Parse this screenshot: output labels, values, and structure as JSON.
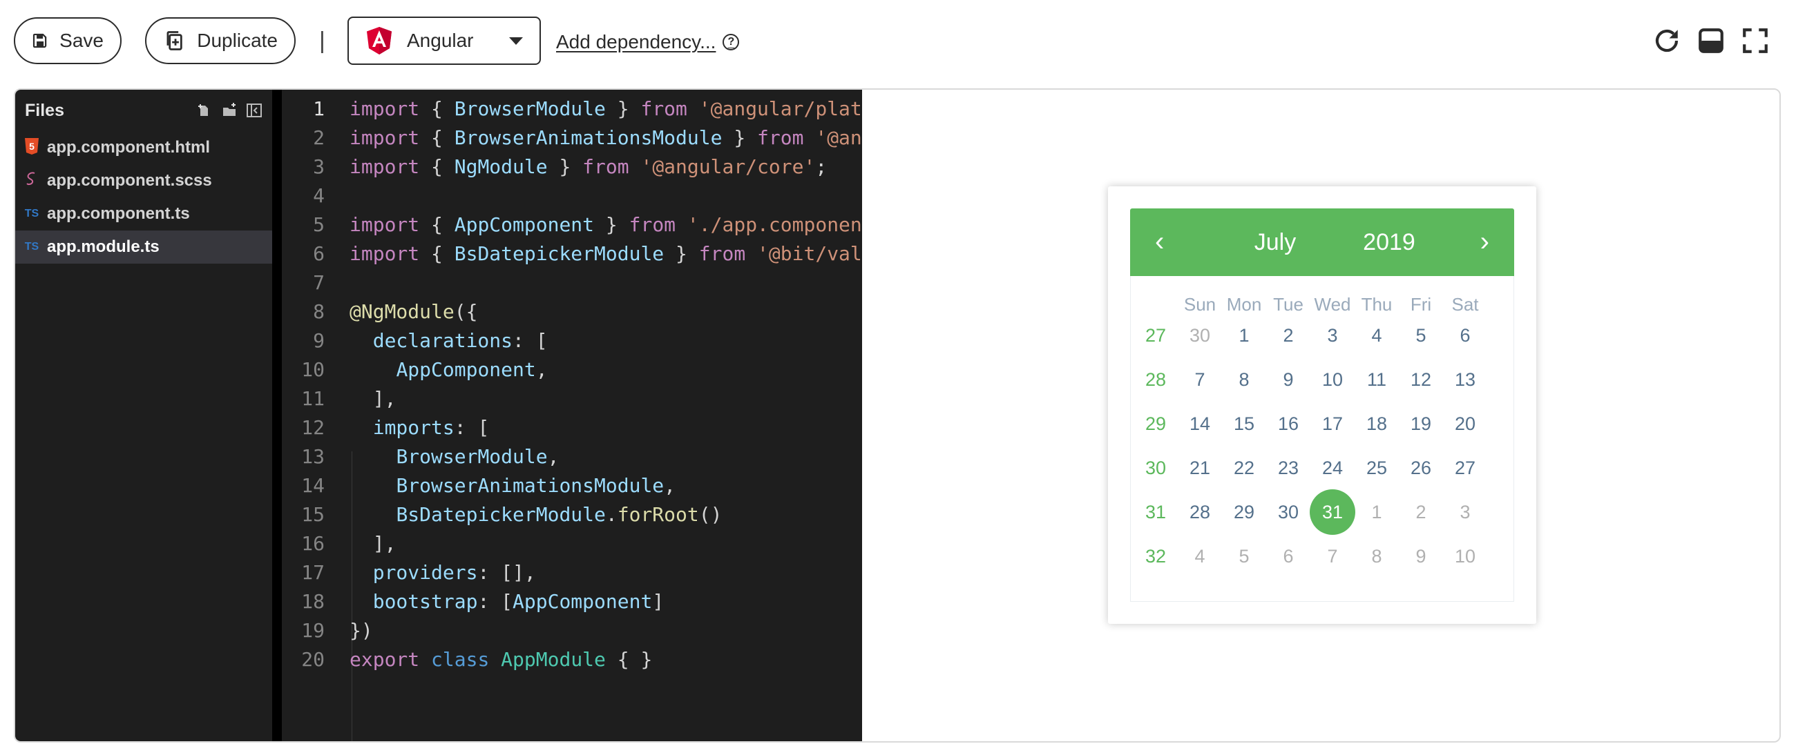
{
  "toolbar": {
    "save_label": "Save",
    "duplicate_label": "Duplicate",
    "separator": "|",
    "framework": "Angular",
    "add_dependency": "Add dependency...",
    "help": "?"
  },
  "files": {
    "header": "Files",
    "items": [
      {
        "name": "app.component.html",
        "icon": "html5-icon",
        "badge": "5"
      },
      {
        "name": "app.component.scss",
        "icon": "sass-icon",
        "badge": "S"
      },
      {
        "name": "app.component.ts",
        "icon": "typescript-icon",
        "badge": "TS"
      },
      {
        "name": "app.module.ts",
        "icon": "typescript-icon",
        "badge": "TS",
        "active": true
      }
    ]
  },
  "editor": {
    "line_numbers": [
      "1",
      "2",
      "3",
      "4",
      "5",
      "6",
      "7",
      "8",
      "9",
      "10",
      "11",
      "12",
      "13",
      "14",
      "15",
      "16",
      "17",
      "18",
      "19",
      "20"
    ],
    "lines": [
      "import { BrowserModule } from '@angular/plat",
      "import { BrowserAnimationsModule } from '@an",
      "import { NgModule } from '@angular/core';",
      "",
      "import { AppComponent } from './app.componen",
      "import { BsDatepickerModule } from '@bit/val",
      "",
      "@NgModule({",
      "  declarations: [",
      "    AppComponent,",
      "  ],",
      "  imports: [",
      "    BrowserModule,",
      "    BrowserAnimationsModule,",
      "    BsDatepickerModule.forRoot()",
      "  ],",
      "  providers: [],",
      "  bootstrap: [AppComponent]",
      "})",
      "export class AppModule { }"
    ]
  },
  "datepicker": {
    "prev": "‹",
    "next": "›",
    "month": "July",
    "year": "2019",
    "weekdays": [
      "Sun",
      "Mon",
      "Tue",
      "Wed",
      "Thu",
      "Fri",
      "Sat"
    ],
    "weeks": [
      {
        "week": "27",
        "days": [
          "30",
          "1",
          "2",
          "3",
          "4",
          "5",
          "6"
        ]
      },
      {
        "week": "28",
        "days": [
          "7",
          "8",
          "9",
          "10",
          "11",
          "12",
          "13"
        ]
      },
      {
        "week": "29",
        "days": [
          "14",
          "15",
          "16",
          "17",
          "18",
          "19",
          "20"
        ]
      },
      {
        "week": "30",
        "days": [
          "21",
          "22",
          "23",
          "24",
          "25",
          "26",
          "27"
        ]
      },
      {
        "week": "31",
        "days": [
          "28",
          "29",
          "30",
          "31",
          "1",
          "2",
          "3"
        ]
      },
      {
        "week": "32",
        "days": [
          "4",
          "5",
          "6",
          "7",
          "8",
          "9",
          "10"
        ]
      }
    ],
    "muted": [
      [
        0,
        0
      ],
      [
        4,
        4
      ],
      [
        4,
        5
      ],
      [
        4,
        6
      ],
      [
        5,
        0
      ],
      [
        5,
        1
      ],
      [
        5,
        2
      ],
      [
        5,
        3
      ],
      [
        5,
        4
      ],
      [
        5,
        5
      ],
      [
        5,
        6
      ]
    ],
    "selected": [
      4,
      3
    ],
    "accent": "#5cb85c"
  }
}
